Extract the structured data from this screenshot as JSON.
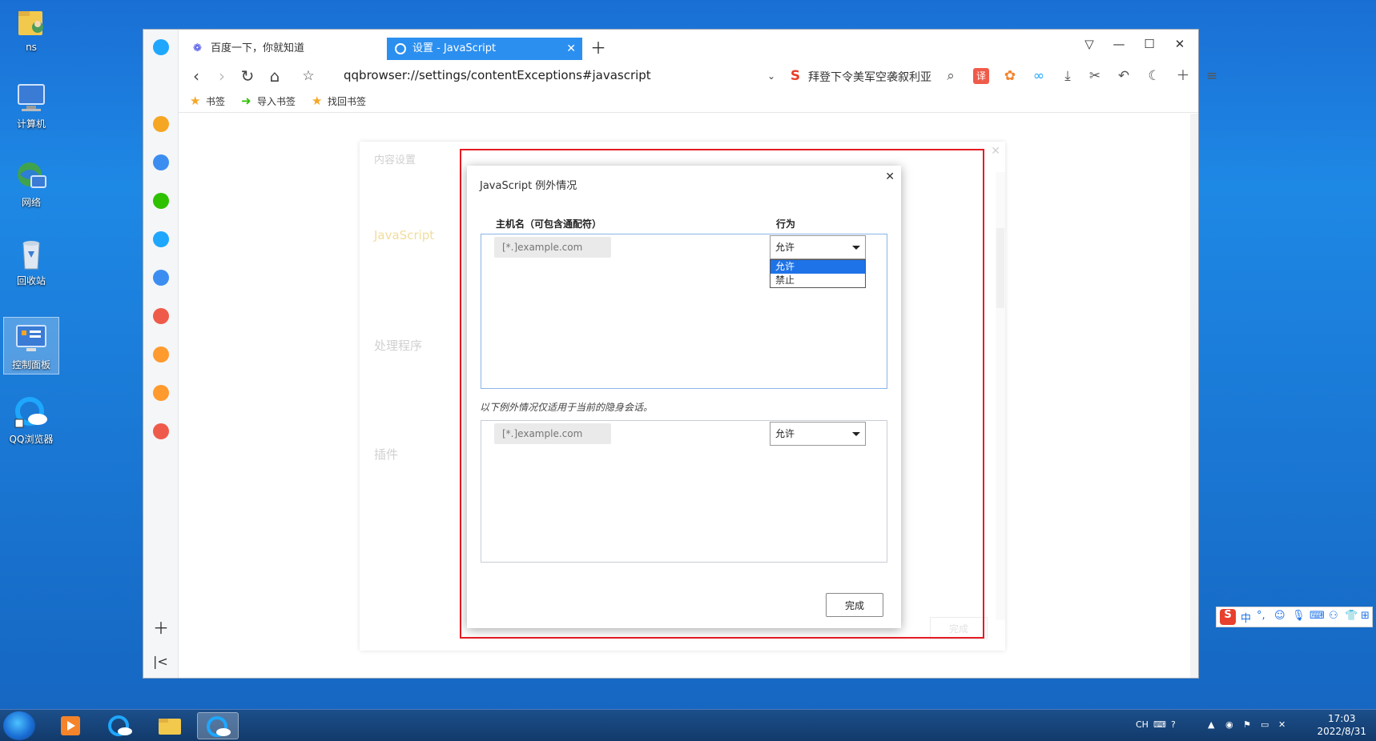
{
  "desktop": {
    "icons": [
      {
        "label": "ns",
        "icon": "folder-user-icon"
      },
      {
        "label": "计算机",
        "icon": "computer-icon"
      },
      {
        "label": "网络",
        "icon": "network-icon"
      },
      {
        "label": "回收站",
        "icon": "recycle-bin-icon"
      },
      {
        "label": "控制面板",
        "icon": "control-panel-icon"
      },
      {
        "label": "QQ浏览器",
        "icon": "qq-browser-icon"
      }
    ]
  },
  "browser": {
    "tabs": [
      {
        "label": "百度一下，你就知道",
        "active": false
      },
      {
        "label": "设置 - JavaScript",
        "active": true
      }
    ],
    "url": "qqbrowser://settings/contentExceptions#javascript",
    "news_ticker": "拜登下令美军空袭叙利亚",
    "bookmarks": [
      {
        "label": "书签"
      },
      {
        "label": "导入书签"
      },
      {
        "label": "找回书签"
      }
    ]
  },
  "settings_bg": {
    "section_content": "内容设置",
    "section_js": "JavaScript",
    "section_handlers": "处理程序",
    "section_plugins": "插件",
    "done_label": "完成"
  },
  "dialog": {
    "title": "JavaScript 例外情况",
    "col_host": "主机名（可包含通配符）",
    "col_behavior": "行为",
    "host_placeholder": "[*.]example.com",
    "behavior_selected": "允许",
    "behavior_options": [
      "允许",
      "禁止"
    ],
    "incognito_note": "以下例外情况仅适用于当前的隐身会话。",
    "incognito_host_placeholder": "[*.]example.com",
    "incognito_behavior": "允许",
    "done_label": "完成"
  },
  "ime": {
    "lang": "中"
  },
  "taskbar": {
    "lang": "CH",
    "time": "17:03",
    "date": "2022/8/31"
  },
  "colors": {
    "accent": "#2b8ff0",
    "highlight_border": "#e51c23",
    "dropdown_selected": "#1e73e8"
  }
}
